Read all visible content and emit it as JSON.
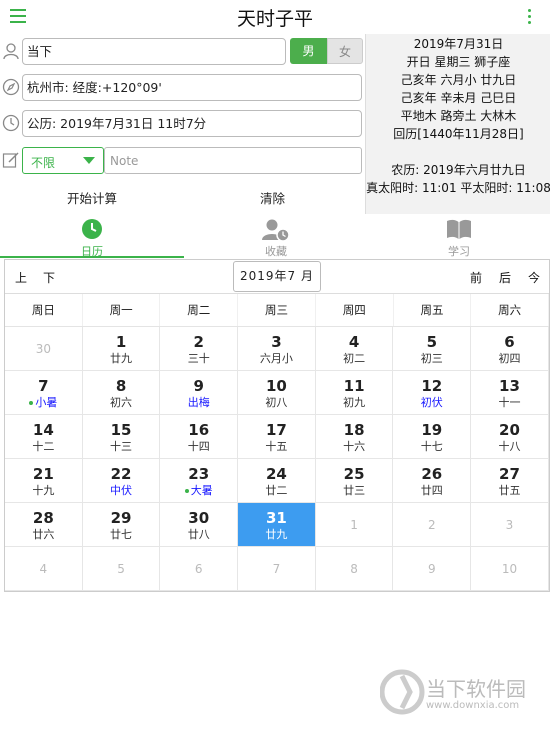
{
  "app": {
    "title": "天时子平"
  },
  "input": {
    "name_value": "当下",
    "gender_male": "男",
    "gender_female": "女",
    "location_value": "杭州市: 经度:+120°09'",
    "date_value": "公历: 2019年7月31日 11时7分",
    "filter_value": "不限",
    "note_placeholder": "Note"
  },
  "info": {
    "lines": [
      "2019年7月31日",
      "开日 星期三 狮子座",
      "己亥年 六月小 廿九日",
      "己亥年 辛未月 己巳日",
      "平地木 路旁土 大林木",
      "回历[1440年11月28日]",
      "",
      "农历: 2019年六月廿九日",
      "真太阳时: 11:01 平太阳时: 11:08"
    ]
  },
  "actions": {
    "compute": "开始计算",
    "clear": "清除"
  },
  "tabs": [
    {
      "label": "日历"
    },
    {
      "label": "收藏"
    },
    {
      "label": "学习"
    }
  ],
  "calendar": {
    "nav": {
      "up": "上",
      "down": "下",
      "prev": "前",
      "next": "后",
      "today": "今"
    },
    "month_label": "2019年7 月",
    "weekdays": [
      "周日",
      "周一",
      "周二",
      "周三",
      "周四",
      "周五",
      "周六"
    ],
    "days": [
      {
        "d": "30",
        "l": "",
        "dim": true
      },
      {
        "d": "1",
        "l": "廿九"
      },
      {
        "d": "2",
        "l": "三十"
      },
      {
        "d": "3",
        "l": "六月小"
      },
      {
        "d": "4",
        "l": "初二"
      },
      {
        "d": "5",
        "l": "初三"
      },
      {
        "d": "6",
        "l": "初四"
      },
      {
        "d": "7",
        "l": "小暑",
        "hl": true,
        "dot": true
      },
      {
        "d": "8",
        "l": "初六"
      },
      {
        "d": "9",
        "l": "出梅",
        "hl": true
      },
      {
        "d": "10",
        "l": "初八"
      },
      {
        "d": "11",
        "l": "初九"
      },
      {
        "d": "12",
        "l": "初伏",
        "hl": true
      },
      {
        "d": "13",
        "l": "十一"
      },
      {
        "d": "14",
        "l": "十二"
      },
      {
        "d": "15",
        "l": "十三"
      },
      {
        "d": "16",
        "l": "十四"
      },
      {
        "d": "17",
        "l": "十五"
      },
      {
        "d": "18",
        "l": "十六"
      },
      {
        "d": "19",
        "l": "十七"
      },
      {
        "d": "20",
        "l": "十八"
      },
      {
        "d": "21",
        "l": "十九"
      },
      {
        "d": "22",
        "l": "中伏",
        "hl": true
      },
      {
        "d": "23",
        "l": "大暑",
        "hl": true,
        "dot": true
      },
      {
        "d": "24",
        "l": "廿二"
      },
      {
        "d": "25",
        "l": "廿三"
      },
      {
        "d": "26",
        "l": "廿四"
      },
      {
        "d": "27",
        "l": "廿五"
      },
      {
        "d": "28",
        "l": "廿六"
      },
      {
        "d": "29",
        "l": "廿七"
      },
      {
        "d": "30",
        "l": "廿八"
      },
      {
        "d": "31",
        "l": "廿九",
        "sel": true
      },
      {
        "d": "1",
        "l": "",
        "dim": true
      },
      {
        "d": "2",
        "l": "",
        "dim": true
      },
      {
        "d": "3",
        "l": "",
        "dim": true
      },
      {
        "d": "4",
        "l": "",
        "dim": true
      },
      {
        "d": "5",
        "l": "",
        "dim": true
      },
      {
        "d": "6",
        "l": "",
        "dim": true
      },
      {
        "d": "7",
        "l": "",
        "dim": true
      },
      {
        "d": "8",
        "l": "",
        "dim": true
      },
      {
        "d": "9",
        "l": "",
        "dim": true
      },
      {
        "d": "10",
        "l": "",
        "dim": true
      }
    ]
  },
  "watermark": {
    "brand": "当下软件园",
    "url": "www.downxia.com"
  },
  "colors": {
    "accent": "#3bb34a",
    "selected": "#3d9cf0",
    "festival": "#1a1aff"
  }
}
